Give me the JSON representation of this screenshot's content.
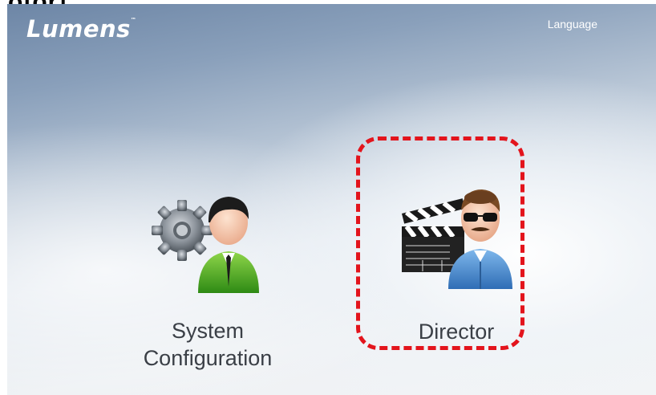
{
  "caption": "otor]",
  "header": {
    "logo_text": "Lumens",
    "logo_trademark": "™",
    "language_label": "Language"
  },
  "tiles": [
    {
      "label_line1": "System",
      "label_line2": "Configuration",
      "icon": "admin-gear-icon"
    },
    {
      "label": "Director",
      "icon": "director-clapperboard-icon"
    }
  ],
  "colors": {
    "highlight_border": "#e3141c",
    "label_text": "#3a3f46"
  }
}
